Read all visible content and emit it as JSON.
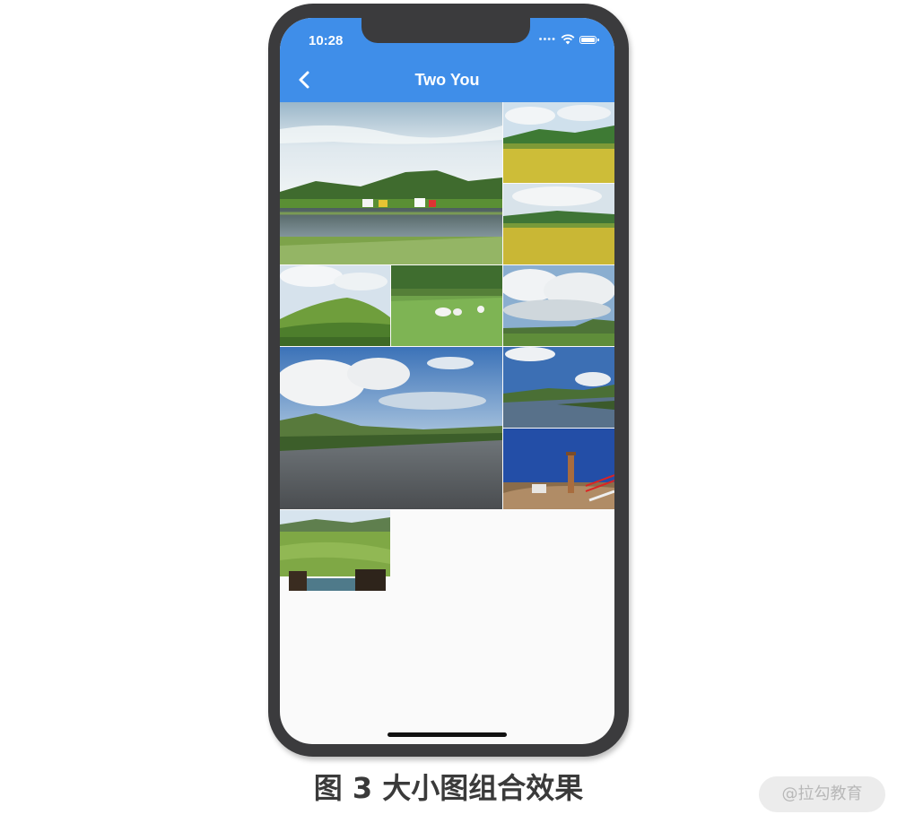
{
  "status_bar": {
    "time": "10:28",
    "icons": [
      "signal-dots-icon",
      "wifi-icon",
      "battery-icon"
    ]
  },
  "app_bar": {
    "title": "Two You",
    "back_icon": "chevron-left-icon",
    "color": "#3f8ee9"
  },
  "grid": {
    "icons": "landscape-photo",
    "photos": [
      "lake-yurts-photo",
      "canola-field-photo-1",
      "canola-field-photo-2",
      "green-hill-photo",
      "white-sheep-photo",
      "cloudy-plain-photo",
      "river-clouds-photo",
      "river-blue-sky-photo",
      "monument-photo",
      "valley-view-photo"
    ]
  },
  "caption": "图 3 大小图组合效果",
  "watermark": "@拉勾教育"
}
